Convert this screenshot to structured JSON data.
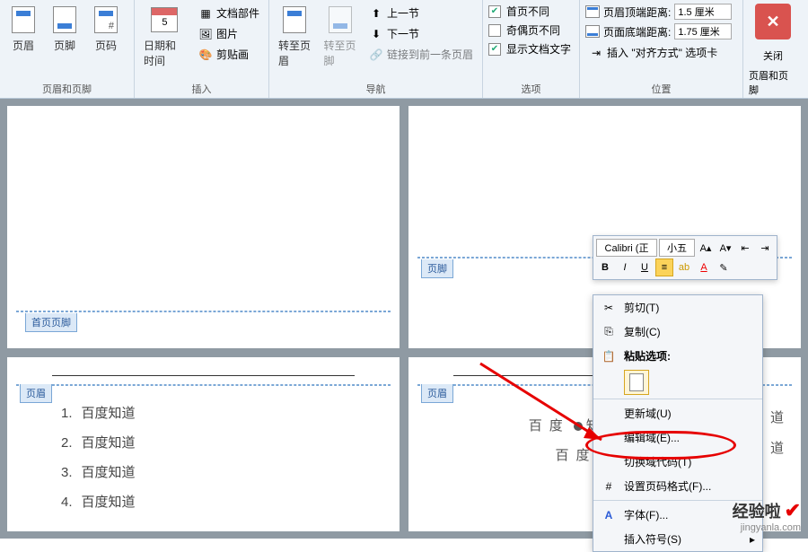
{
  "ribbon": {
    "groups": {
      "hf": {
        "label": "页眉和页脚",
        "header_btn": "页眉",
        "footer_btn": "页脚",
        "pagenum_btn": "页码"
      },
      "insert": {
        "label": "插入",
        "datetime": "日期和时间",
        "quickparts": "文档部件",
        "picture": "图片",
        "clipart": "剪贴画"
      },
      "nav": {
        "label": "导航",
        "goto_header": "转至页眉",
        "goto_footer": "转至页脚",
        "prev": "上一节",
        "next": "下一节",
        "link_prev": "链接到前一条页眉"
      },
      "options": {
        "label": "选项",
        "diff_first": "首页不同",
        "diff_odd_even": "奇偶页不同",
        "show_doc_text": "显示文档文字"
      },
      "position": {
        "label": "位置",
        "header_dist": "页眉顶端距离:",
        "footer_dist": "页面底端距离:",
        "header_val": "1.5 厘米",
        "footer_val": "1.75 厘米",
        "insert_align_tab": "插入 \"对齐方式\" 选项卡"
      },
      "close": {
        "label": "关闭",
        "btn_line1": "关闭",
        "btn_line2": "页眉和页脚"
      }
    }
  },
  "tags": {
    "first_footer": "首页页脚",
    "footer": "页脚",
    "header": "页眉"
  },
  "page3_list": [
    {
      "n": "1.",
      "t": "百度知道"
    },
    {
      "n": "2.",
      "t": "百度知道"
    },
    {
      "n": "3.",
      "t": "百度知道"
    },
    {
      "n": "4.",
      "t": "百度知道"
    }
  ],
  "page4_text": {
    "a": "百度",
    "b": "知道",
    "c": "百"
  },
  "mini_toolbar": {
    "font": "Calibri (正",
    "size": "小五"
  },
  "ctx": {
    "cut": "剪切(T)",
    "copy": "复制(C)",
    "paste_hdr": "粘贴选项:",
    "update_field": "更新域(U)",
    "edit_field": "编辑域(E)...",
    "toggle_field": "切换域代码(T)",
    "page_num_format": "设置页码格式(F)...",
    "font": "字体(F)...",
    "symbol": "插入符号(S)"
  },
  "watermark": {
    "main": "经验啦",
    "sub": "jingyanla.com"
  },
  "page4_trail": "道"
}
